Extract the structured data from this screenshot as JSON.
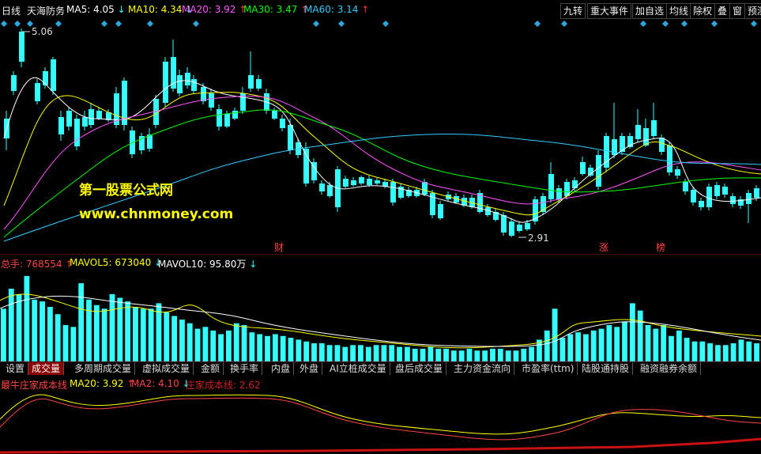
{
  "header": {
    "period": "日线",
    "stock": "天海防务",
    "ma5": {
      "label": "MA5: 4.05",
      "arrow": "↓",
      "color": "#ffffff"
    },
    "ma10": {
      "label": "MA10: 4.34",
      "arrow": "↓",
      "color": "#ffff00"
    },
    "ma20": {
      "label": "MA20: 3.92",
      "arrow": "↑",
      "color": "#ff55ff"
    },
    "ma30": {
      "label": "MA30: 3.47",
      "arrow": "↑",
      "color": "#00ff00"
    },
    "ma60": {
      "label": "MA60: 3.14",
      "arrow": "↑",
      "color": "#33ccff"
    }
  },
  "toolbar": [
    "九转",
    "重大事件",
    "加自选",
    "均线",
    "除权",
    "叠",
    "窗",
    "预测"
  ],
  "price_marks": {
    "high": "5.06",
    "low": "2.91"
  },
  "event_labels": [
    "财",
    "涨",
    "榜"
  ],
  "watermark": {
    "line1": "第一股票公式网",
    "line2": "www.chnmoney.com"
  },
  "volume_header": {
    "total": {
      "label": "总手: 768554",
      "arrow": "↑",
      "color": "#ff4444"
    },
    "mavol5": {
      "label": "MAVOL5: 673040",
      "arrow": "↓",
      "color": "#ffff00"
    },
    "mavol10": {
      "label": "MAVOL10: 95.80万",
      "arrow": "↓",
      "color": "#ffffff"
    }
  },
  "tabs": [
    {
      "label": "设置",
      "active": false
    },
    {
      "label": "成交量",
      "active": true
    },
    {
      "label": "多周期成交量",
      "active": false
    },
    {
      "label": "虚拟成交量",
      "active": false
    },
    {
      "label": "金额",
      "active": false
    },
    {
      "label": "换手率",
      "active": false
    },
    {
      "label": "内盘",
      "active": false
    },
    {
      "label": "外盘",
      "active": false
    },
    {
      "label": "AI立桩成交量",
      "active": false
    },
    {
      "label": "盘后成交量",
      "active": false
    },
    {
      "label": "主力资金流向",
      "active": false
    },
    {
      "label": "市盈率(ttm)",
      "active": false
    },
    {
      "label": "陆股通持股",
      "active": false
    },
    {
      "label": "融资融券余额",
      "active": false
    }
  ],
  "indicator_header": {
    "name": {
      "label": "最牛庄家成本线",
      "color": "#ff4444"
    },
    "ma20": {
      "label": "MA20: 3.92",
      "arrow": "↑",
      "color": "#ffff00"
    },
    "ma2": {
      "label": "MA2: 4.10",
      "arrow": "↓",
      "color": "#ff4444"
    },
    "cost": {
      "label": "庄家成本线: 2.62",
      "color": "#cc2222"
    }
  },
  "colors": {
    "up": "#ff3333",
    "down": "#33ffff",
    "grid": "#8b1a1a",
    "diamond": "#2aa8e0"
  }
}
